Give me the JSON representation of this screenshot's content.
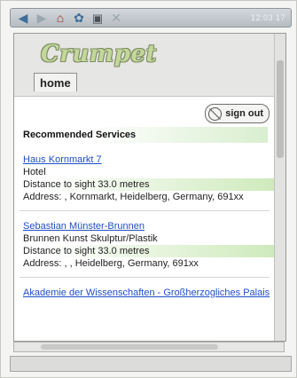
{
  "toolbar": {
    "buttons": [
      {
        "icon": "back-arrow-icon"
      },
      {
        "icon": "forward-arrow-icon"
      },
      {
        "icon": "home-icon"
      },
      {
        "icon": "settings-icon"
      },
      {
        "icon": "save-icon"
      },
      {
        "icon": "stop-icon"
      }
    ],
    "clock": "12:03 17"
  },
  "page": {
    "logo": "Crumpet",
    "tab": "home",
    "signout_label": "sign out",
    "section_title": "Recommended Services",
    "services": [
      {
        "name": "Haus Kornmarkt 7",
        "type": "Hotel",
        "distance": "Distance to sight 33.0 metres",
        "address": "Address: , Kornmarkt, Heidelberg, Germany, 691xx"
      },
      {
        "name": "Sebastian Münster-Brunnen",
        "type": "Brunnen Kunst Skulptur/Plastik",
        "distance": "Distance to sight 33.0 metres",
        "address": "Address: , , Heidelberg, Germany, 691xx"
      },
      {
        "name": "Akademie der Wissenschaften - Großherzogliches Palais"
      }
    ]
  },
  "colors": {
    "link": "#1f4fc8",
    "highlight": "#cfeabd",
    "logo_fill": "#c3d89a"
  }
}
